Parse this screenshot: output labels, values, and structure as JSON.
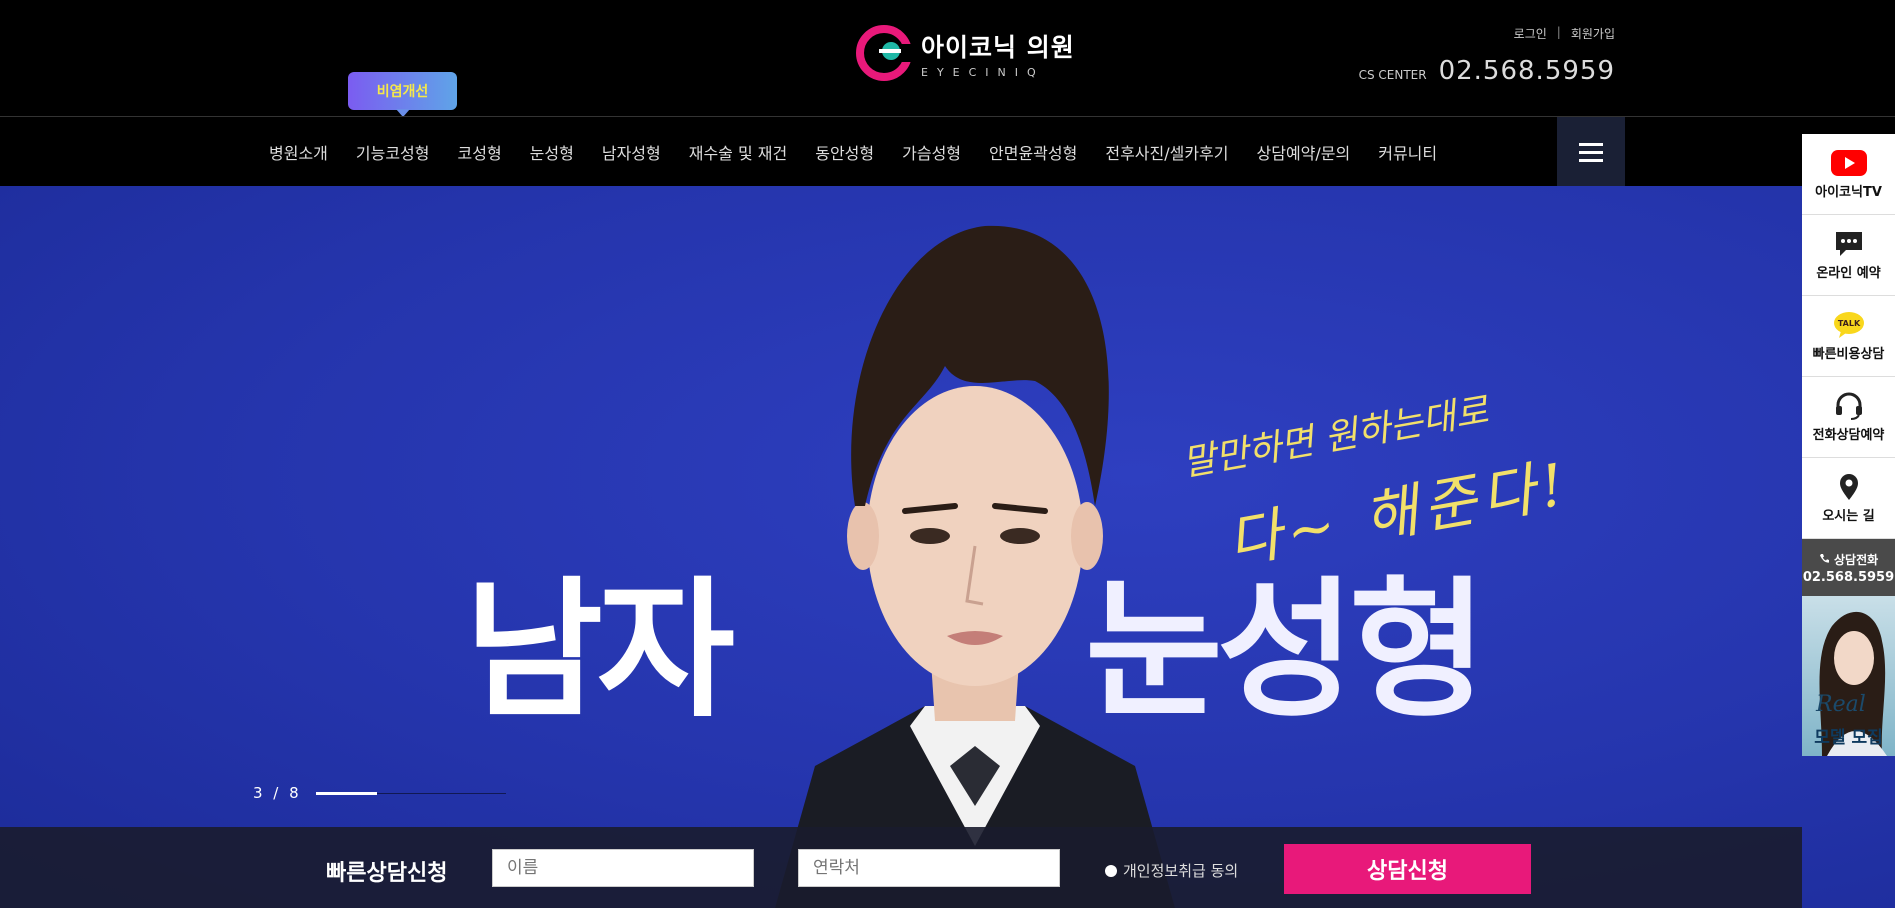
{
  "header": {
    "logo_name": "아이코닉 의원",
    "logo_eng": "EYECINIQ",
    "login": "로그인",
    "separator": "|",
    "signup": "회원가입",
    "cs_label": "CS CENTER",
    "cs_number": "02.568.5959",
    "promo_tag": "비염개선"
  },
  "nav": {
    "items": [
      "병원소개",
      "기능코성형",
      "코성형",
      "눈성형",
      "남자성형",
      "재수술 및 재건",
      "동안성형",
      "가슴성형",
      "안면윤곽성형",
      "전후사진/셀카후기",
      "상담예약/문의",
      "커뮤니티"
    ]
  },
  "hero": {
    "title_left": "남자",
    "title_right": "눈성형",
    "tagline_1": "말만하면 원하는대로",
    "tagline_2": "다~ 해준다!",
    "slide_counter": "3 / 8",
    "slide_progress": 0.32
  },
  "consult": {
    "title": "빠른상담신청",
    "name_placeholder": "이름",
    "phone_placeholder": "연락처",
    "agree_label": "개인정보취급 동의",
    "submit": "상담신청"
  },
  "quick_menu": {
    "items": [
      {
        "label": "아이코닉TV",
        "icon": "youtube-icon"
      },
      {
        "label": "온라인 예약",
        "icon": "chat-icon"
      },
      {
        "label": "빠른비용상담",
        "icon": "kakao-talk-icon"
      },
      {
        "label": "전화상담예약",
        "icon": "headset-icon"
      },
      {
        "label": "오시는 길",
        "icon": "map-pin-icon"
      }
    ],
    "call_label": "상담전화",
    "call_number": "02.568.5959",
    "banner_real": "Real",
    "banner_text": "모델 모집"
  },
  "colors": {
    "accent": "#e8197a",
    "hero_bg": "#2535ad",
    "tagline": "#f2e06a"
  }
}
